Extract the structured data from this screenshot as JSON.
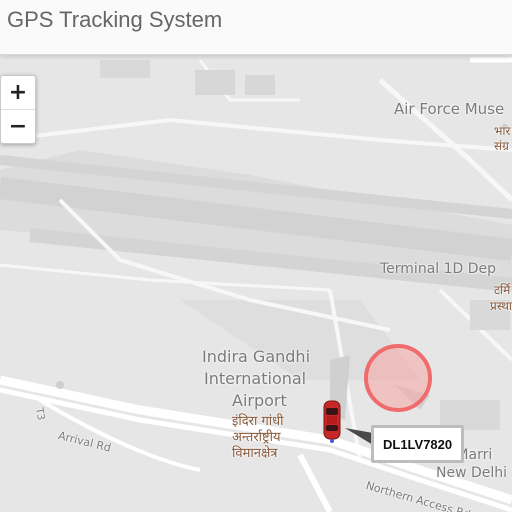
{
  "header": {
    "title": "GPS Tracking System"
  },
  "zoom": {
    "in_label": "+",
    "out_label": "−"
  },
  "map": {
    "pois": {
      "air_force_museum_en": "Air Force Muse",
      "air_force_museum_hi_1": "भार",
      "air_force_museum_hi_2": "संग्र",
      "terminal_1d_en": "Terminal 1D Dep",
      "terminal_1d_hi_1": "टर्मि",
      "terminal_1d_hi_2": "प्रस्था",
      "airport_en_1": "Indira Gandhi",
      "airport_en_2": "International",
      "airport_en_3": "Airport",
      "airport_hi_1": "इंदिरा गांधी",
      "airport_hi_2": "अन्तर्राष्ट्रीय",
      "airport_hi_3": "विमानक्षेत्र",
      "jw_marriott_1": "JW Marri",
      "jw_marriott_2": "New Delhi",
      "arrival_rd": "Arrival Rd",
      "t3_badge": "T3",
      "northern_access": "Northern Access Rd"
    },
    "vehicle": {
      "plate": "DL1LV7820",
      "color": "#c62828",
      "icon": "car-icon"
    },
    "geofence_color": "#f06b6b"
  }
}
